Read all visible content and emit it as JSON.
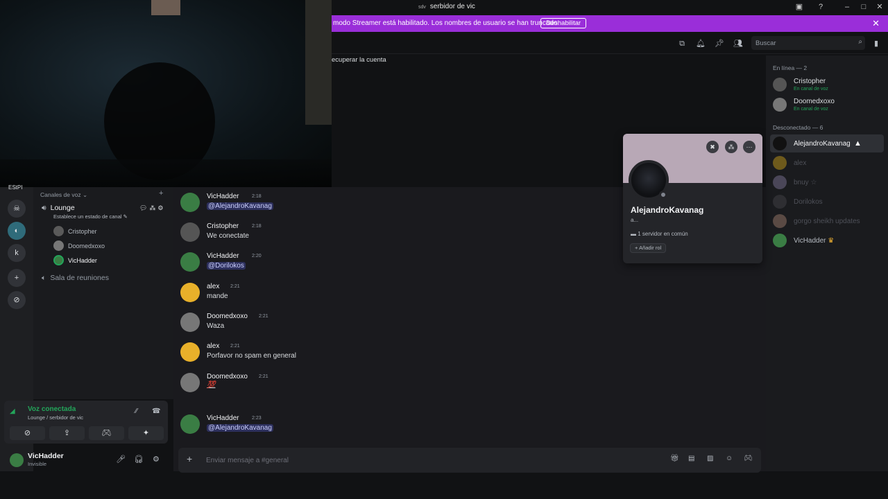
{
  "window": {
    "server_tag": "sdv",
    "title": "serbidor de vic"
  },
  "banner": {
    "text": "modo Streamer está habilitado. Los nombres de usuario se han truncado.",
    "button": "Deshabilitar"
  },
  "header": {
    "search_placeholder": "Buscar"
  },
  "recover_text": "ecuperar la cuenta",
  "guilds": {
    "label": "EStPI",
    "letter": "k"
  },
  "sidebar": {
    "category": "Canales de voz",
    "voice_channel": {
      "name": "Lounge",
      "status": "Establece un estado de canal",
      "users": [
        "Cristopher",
        "Doomedxoxo",
        "VicHadder"
      ]
    },
    "second_channel": "Sala de reuniones"
  },
  "voice_panel": {
    "title": "Voz conectada",
    "subtitle": "Lounge / serbidor de vic"
  },
  "user_panel": {
    "name": "VicHadder",
    "status": "Invisible"
  },
  "messages": [
    {
      "author": "VicHadder",
      "time": "2:18",
      "text": "@AlejandroKavanag",
      "mention": true
    },
    {
      "author": "Cristopher",
      "time": "2:18",
      "text": "We conectate",
      "mention": false
    },
    {
      "author": "VicHadder",
      "time": "2:20",
      "text": "@Dorilokos",
      "mention": true
    },
    {
      "author": "alex",
      "time": "2:21",
      "text": "mande",
      "mention": false
    },
    {
      "author": "Doomedxoxo",
      "time": "2:21",
      "text": "Waza",
      "mention": false
    },
    {
      "author": "alex",
      "time": "2:21",
      "text": "Porfavor no spam en general",
      "mention": false
    },
    {
      "author": "Doomedxoxo",
      "time": "2:21",
      "text": "💯",
      "mention": false
    },
    {
      "author": "VicHadder",
      "time": "2:23",
      "text": "@AlejandroKavanag",
      "mention": true
    }
  ],
  "composer": {
    "placeholder": "Enviar mensaje a #general"
  },
  "members": {
    "online_header": "En línea — 2",
    "online": [
      {
        "name": "Cristopher",
        "status": "En canal de voz"
      },
      {
        "name": "Doomedxoxo",
        "status": "En canal de voz"
      }
    ],
    "offline_header": "Desconectado — 6",
    "offline": [
      "AlejandroKavanag",
      "alex",
      "bnuy ☆",
      "Dorilokos",
      "gorgo sheikh updates",
      "VicHadder"
    ]
  },
  "profile_popout": {
    "name": "AlejandroKavanag",
    "sub": "a...",
    "common": "1 servidor en común",
    "add_role": "Añadir rol"
  },
  "colors": {
    "banner": "#9a2ed9",
    "voice_green": "#23a55a",
    "mention": "#c9cdfb"
  }
}
